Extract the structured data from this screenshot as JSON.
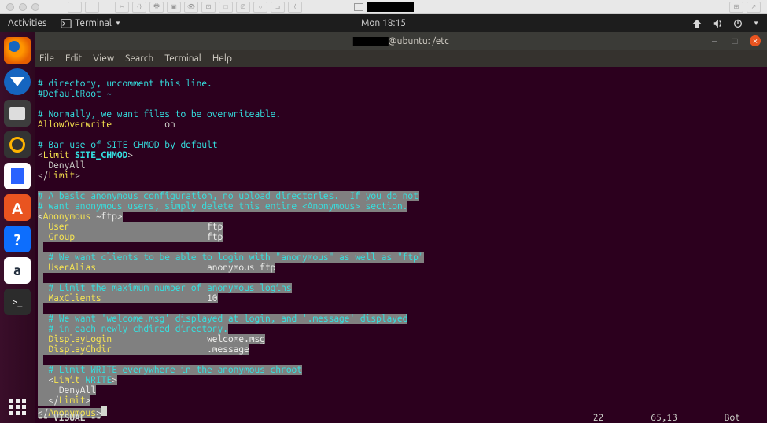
{
  "topbar": {
    "activities": "Activities",
    "terminal_indicator": "Terminal",
    "clock": "Mon 18:15"
  },
  "launcher": {
    "software_glyph": "A",
    "help_glyph": "?",
    "amazon_glyph": "a",
    "term_glyph": ">_"
  },
  "window": {
    "title_suffix": "@ubuntu: /etc"
  },
  "menu": {
    "file": "File",
    "edit": "Edit",
    "view": "View",
    "search": "Search",
    "terminal": "Terminal",
    "help": "Help"
  },
  "editor": {
    "l1": "# directory, uncomment this line.",
    "l2": "#DefaultRoot ~",
    "l3": "# Normally, we want files to be overwriteable.",
    "l4a": "AllowOverwrite",
    "l4b": "on",
    "l5": "# Bar use of SITE CHMOD by default",
    "l6a": "<",
    "l6b": "Limit",
    "l6c": " SITE_CHMOD",
    "l6d": ">",
    "l7": "  DenyAll",
    "l8a": "</",
    "l8b": "Limit",
    "l8c": ">",
    "l9": "# A basic anonymous configuration, no upload directories.  If you do not",
    "l10": "# want anonymous users, simply delete this entire <Anonymous> section.",
    "l11a": "<",
    "l11b": "Anonymous",
    "l11c": " ~ftp",
    "l11d": ">",
    "l12a": "  User",
    "l12b": "ftp",
    "l13a": "  Group",
    "l13b": "ftp",
    "l14": "  # We want clients to be able to login with \"anonymous\" as well as \"ftp\"",
    "l15a": "  UserAlias",
    "l15b": "anonymous ftp",
    "l16": "  # Limit the maximum number of anonymous logins",
    "l17a": "  MaxClients",
    "l17b": "10",
    "l18": "  # We want 'welcome.msg' displayed at login, and '.message' displayed",
    "l19": "  # in each newly chdired directory.",
    "l20a": "  DisplayLogin",
    "l20b": "welcome.msg",
    "l21a": "  DisplayChdir",
    "l21b": ".message",
    "l22": "  # Limit WRITE everywhere in the anonymous chroot",
    "l23a": "  <",
    "l23b": "Limit",
    "l23c": " WRITE",
    "l23d": ">",
    "l24": "    DenyAll",
    "l25a": "  </",
    "l25b": "Limit",
    "l25c": ">",
    "l26a": "</",
    "l26b": "Anonymous",
    "l26c": ">"
  },
  "status": {
    "mode": "-- VISUAL --",
    "lines": "22",
    "pos": "65,13",
    "scroll": "Bot"
  }
}
